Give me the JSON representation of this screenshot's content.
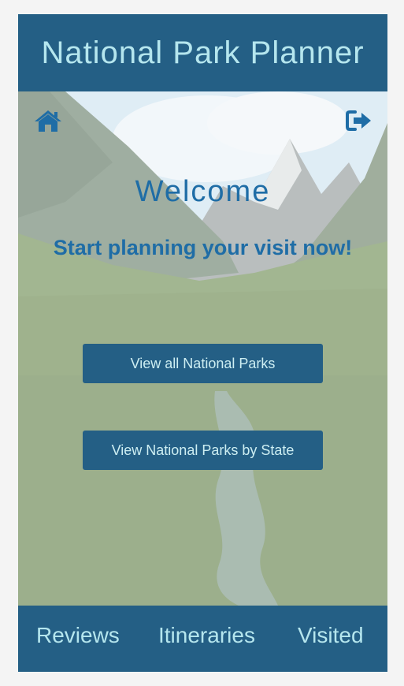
{
  "header": {
    "title": "National Park Planner"
  },
  "toolbar": {
    "home_icon": "home-icon",
    "logout_icon": "sign-out-icon"
  },
  "hero": {
    "welcome": "Welcome",
    "subtitle": "Start planning your visit now!"
  },
  "actions": {
    "view_all": "View all National Parks",
    "view_by_state": "View National Parks by State"
  },
  "footer": {
    "items": [
      {
        "label": "Reviews"
      },
      {
        "label": "Itineraries"
      },
      {
        "label": "Visited"
      }
    ]
  },
  "colors": {
    "primary": "#245f85",
    "header_text": "#b5e6ee",
    "accent_text": "#1f6da6"
  }
}
